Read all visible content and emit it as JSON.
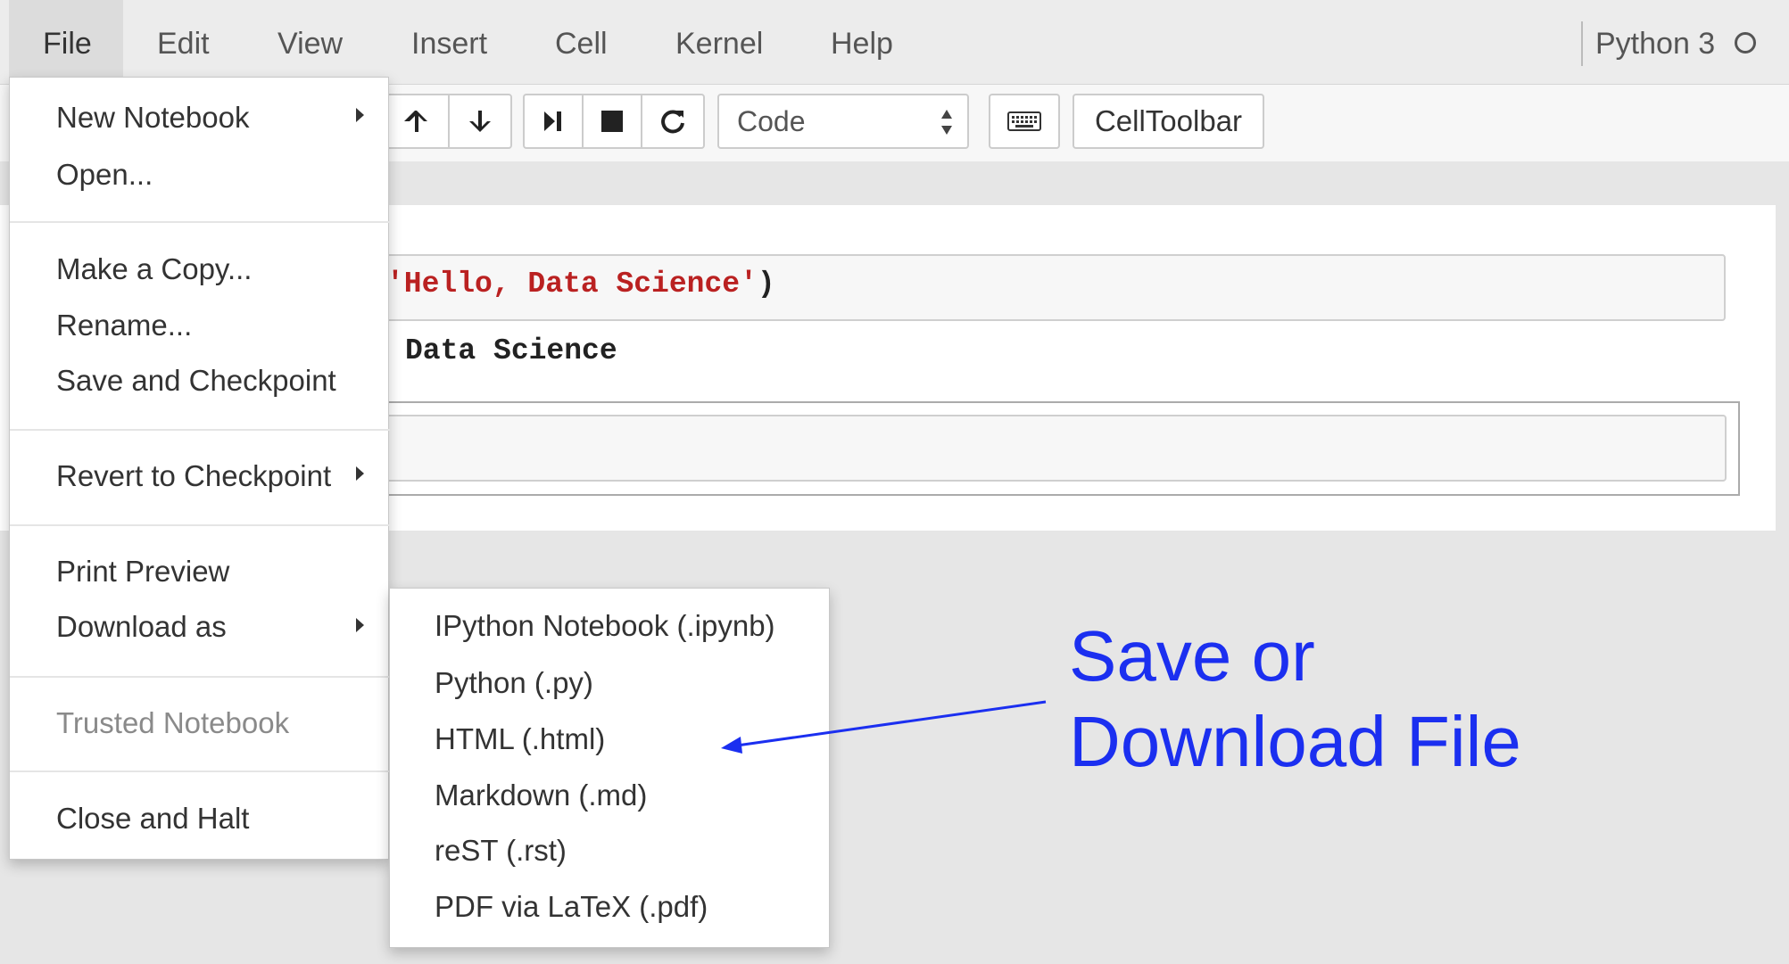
{
  "menubar": {
    "items": [
      "File",
      "Edit",
      "View",
      "Insert",
      "Cell",
      "Kernel",
      "Help"
    ],
    "active_item": "File",
    "kernel_name": "Python 3"
  },
  "toolbar": {
    "buttons": [
      "move-cell-up",
      "move-cell-down",
      "run-cell",
      "interrupt-kernel",
      "restart-kernel"
    ],
    "cell_type": "Code",
    "keyboard_icon": "keyboard-icon",
    "celltoolbar_label": "CellToolbar"
  },
  "notebook": {
    "cell1_string": "'Hello, Data Science'",
    "cell1_close": ")",
    "cell1_output": "Data Science"
  },
  "file_menu": {
    "new_notebook": "New Notebook",
    "open": "Open...",
    "make_copy": "Make a Copy...",
    "rename": "Rename...",
    "save_checkpoint": "Save and Checkpoint",
    "revert": "Revert to Checkpoint",
    "print_preview": "Print Preview",
    "download_as": "Download as",
    "trusted": "Trusted Notebook",
    "close_halt": "Close and Halt"
  },
  "download_submenu": {
    "items": [
      "IPython Notebook (.ipynb)",
      "Python (.py)",
      "HTML (.html)",
      "Markdown (.md)",
      "reST (.rst)",
      "PDF via LaTeX (.pdf)"
    ]
  },
  "annotation": {
    "line1": "Save or",
    "line2": "Download File",
    "color": "#1b2ff0"
  }
}
